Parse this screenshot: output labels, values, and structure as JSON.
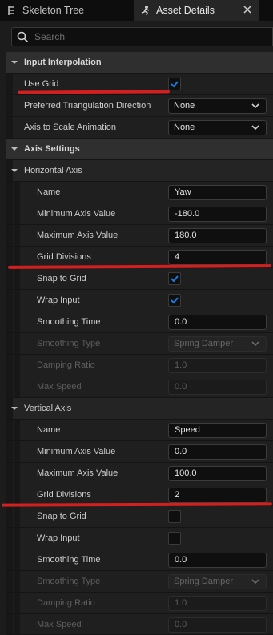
{
  "tabs": [
    {
      "label": "Skeleton Tree",
      "icon": "skeleton-tree-icon"
    },
    {
      "label": "Asset Details",
      "icon": "asset-details-icon"
    }
  ],
  "search": {
    "placeholder": "Search"
  },
  "input_interpolation": {
    "title": "Input Interpolation",
    "use_grid": {
      "label": "Use Grid",
      "checked": true
    },
    "preferred_triangulation": {
      "label": "Preferred Triangulation Direction",
      "value": "None"
    },
    "axis_to_scale": {
      "label": "Axis to Scale Animation",
      "value": "None"
    }
  },
  "axis_settings": {
    "title": "Axis Settings",
    "horizontal": {
      "title": "Horizontal Axis",
      "name": {
        "label": "Name",
        "value": "Yaw"
      },
      "min": {
        "label": "Minimum Axis Value",
        "value": "-180.0"
      },
      "max": {
        "label": "Maximum Axis Value",
        "value": "180.0"
      },
      "grid": {
        "label": "Grid Divisions",
        "value": "4"
      },
      "snap": {
        "label": "Snap to Grid",
        "checked": true
      },
      "wrap": {
        "label": "Wrap Input",
        "checked": true
      },
      "smoothing_time": {
        "label": "Smoothing Time",
        "value": "0.0"
      },
      "smoothing_type": {
        "label": "Smoothing Type",
        "value": "Spring Damper"
      },
      "damping": {
        "label": "Damping Ratio",
        "value": "1.0"
      },
      "max_speed": {
        "label": "Max Speed",
        "value": "0.0"
      }
    },
    "vertical": {
      "title": "Vertical Axis",
      "name": {
        "label": "Name",
        "value": "Speed"
      },
      "min": {
        "label": "Minimum Axis Value",
        "value": "0.0"
      },
      "max": {
        "label": "Maximum Axis Value",
        "value": "100.0"
      },
      "grid": {
        "label": "Grid Divisions",
        "value": "2"
      },
      "snap": {
        "label": "Snap to Grid",
        "checked": false
      },
      "wrap": {
        "label": "Wrap Input",
        "checked": false
      },
      "smoothing_time": {
        "label": "Smoothing Time",
        "value": "0.0"
      },
      "smoothing_type": {
        "label": "Smoothing Type",
        "value": "Spring Damper"
      },
      "damping": {
        "label": "Damping Ratio",
        "value": "1.0"
      },
      "max_speed": {
        "label": "Max Speed",
        "value": "0.0"
      }
    }
  },
  "colors": {
    "annotation_red": "#d21f1f",
    "check_blue": "#1f7ae0"
  }
}
